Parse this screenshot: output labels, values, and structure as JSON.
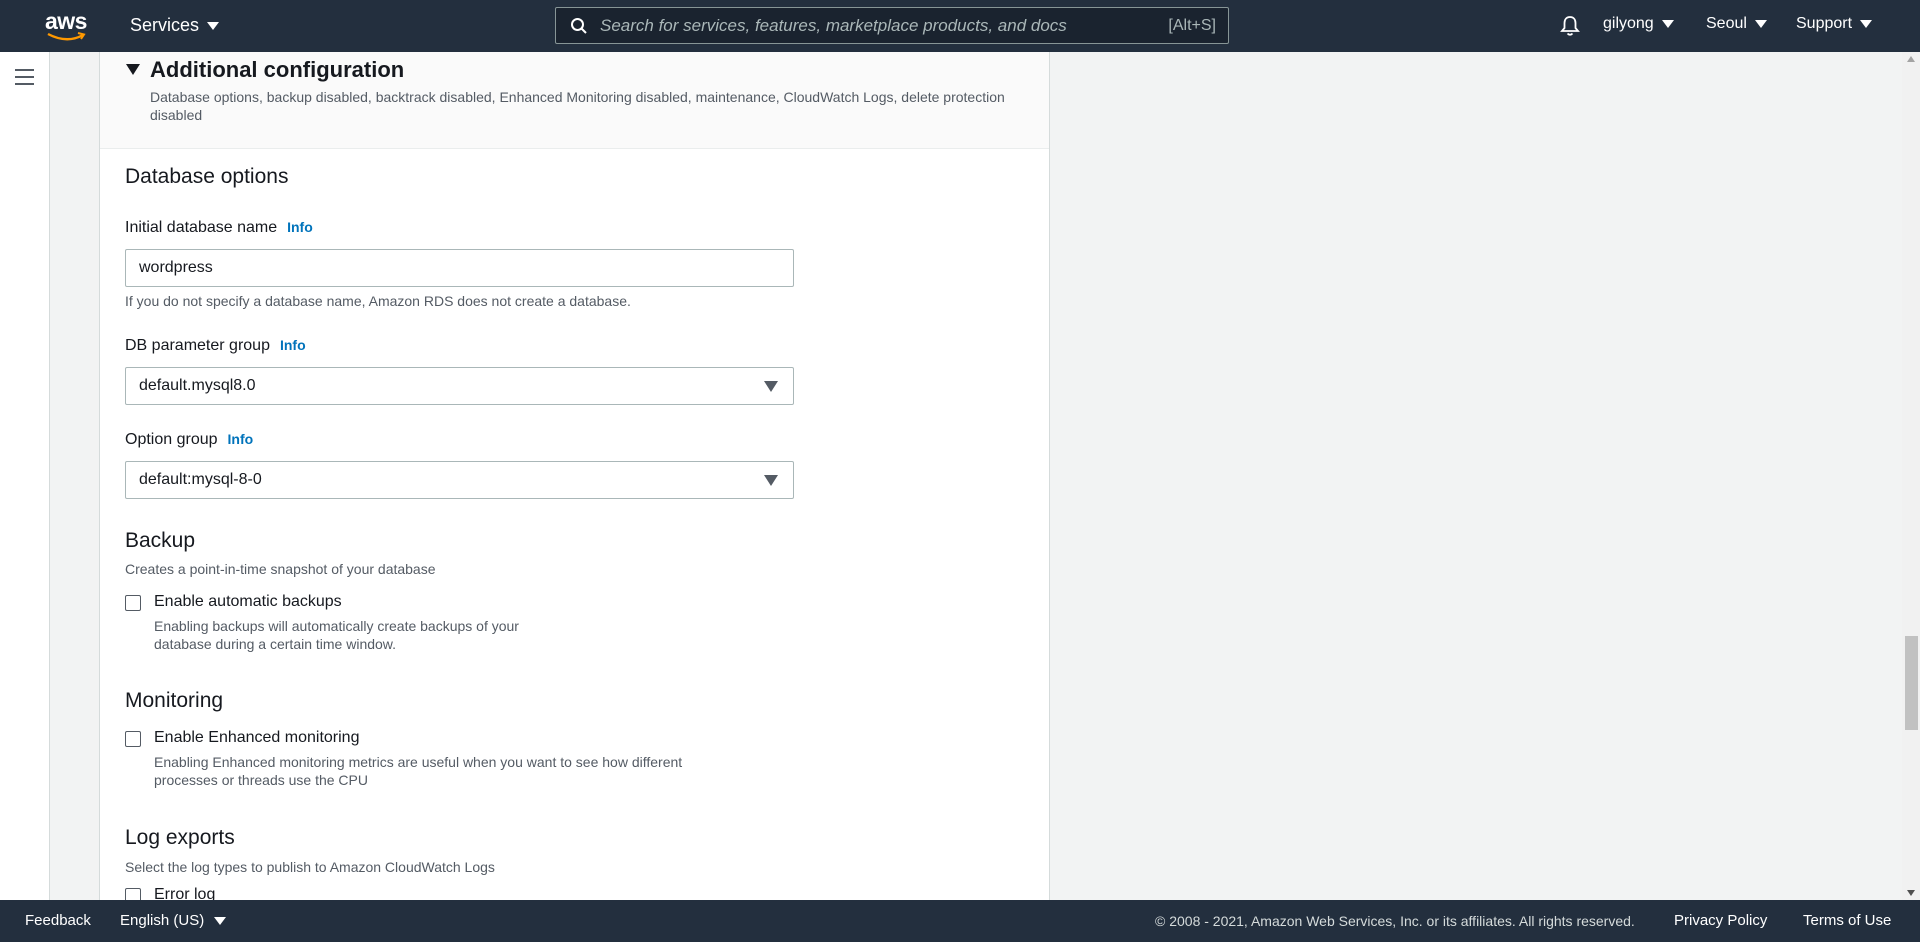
{
  "nav": {
    "logo_text": "aws",
    "services_label": "Services",
    "search_placeholder": "Search for services, features, marketplace products, and docs",
    "search_shortcut": "[Alt+S]",
    "user": "gilyong",
    "region": "Seoul",
    "support": "Support"
  },
  "panel": {
    "section_title": "Additional configuration",
    "section_desc": "Database options, backup disabled, backtrack disabled, Enhanced Monitoring disabled, maintenance, CloudWatch Logs, delete protection disabled",
    "db_options_heading": "Database options",
    "initial_db_label": "Initial database name",
    "info": "Info",
    "initial_db_value": "wordpress",
    "initial_db_help": "If you do not specify a database name, Amazon RDS does not create a database.",
    "param_group_label": "DB parameter group",
    "param_group_value": "default.mysql8.0",
    "option_group_label": "Option group",
    "option_group_value": "default:mysql-8-0",
    "backup_heading": "Backup",
    "backup_desc": "Creates a point-in-time snapshot of your database",
    "backup_cb_label": "Enable automatic backups",
    "backup_cb_desc1": "Enabling backups will automatically create backups of your",
    "backup_cb_desc2": "database during a certain time window.",
    "monitoring_heading": "Monitoring",
    "monitoring_cb_label": "Enable Enhanced monitoring",
    "monitoring_cb_desc1": "Enabling Enhanced monitoring metrics are useful when you want to see how different",
    "monitoring_cb_desc2": "processes or threads use the CPU",
    "log_heading": "Log exports",
    "log_desc": "Select the log types to publish to Amazon CloudWatch Logs",
    "error_log_label": "Error log"
  },
  "footer": {
    "feedback": "Feedback",
    "language": "English (US)",
    "copyright": "© 2008 - 2021, Amazon Web Services, Inc. or its affiliates. All rights reserved.",
    "privacy": "Privacy Policy",
    "terms": "Terms of Use"
  },
  "colors": {
    "nav_bg": "#232f3e",
    "link": "#0073bb",
    "smile": "#ff9900"
  }
}
